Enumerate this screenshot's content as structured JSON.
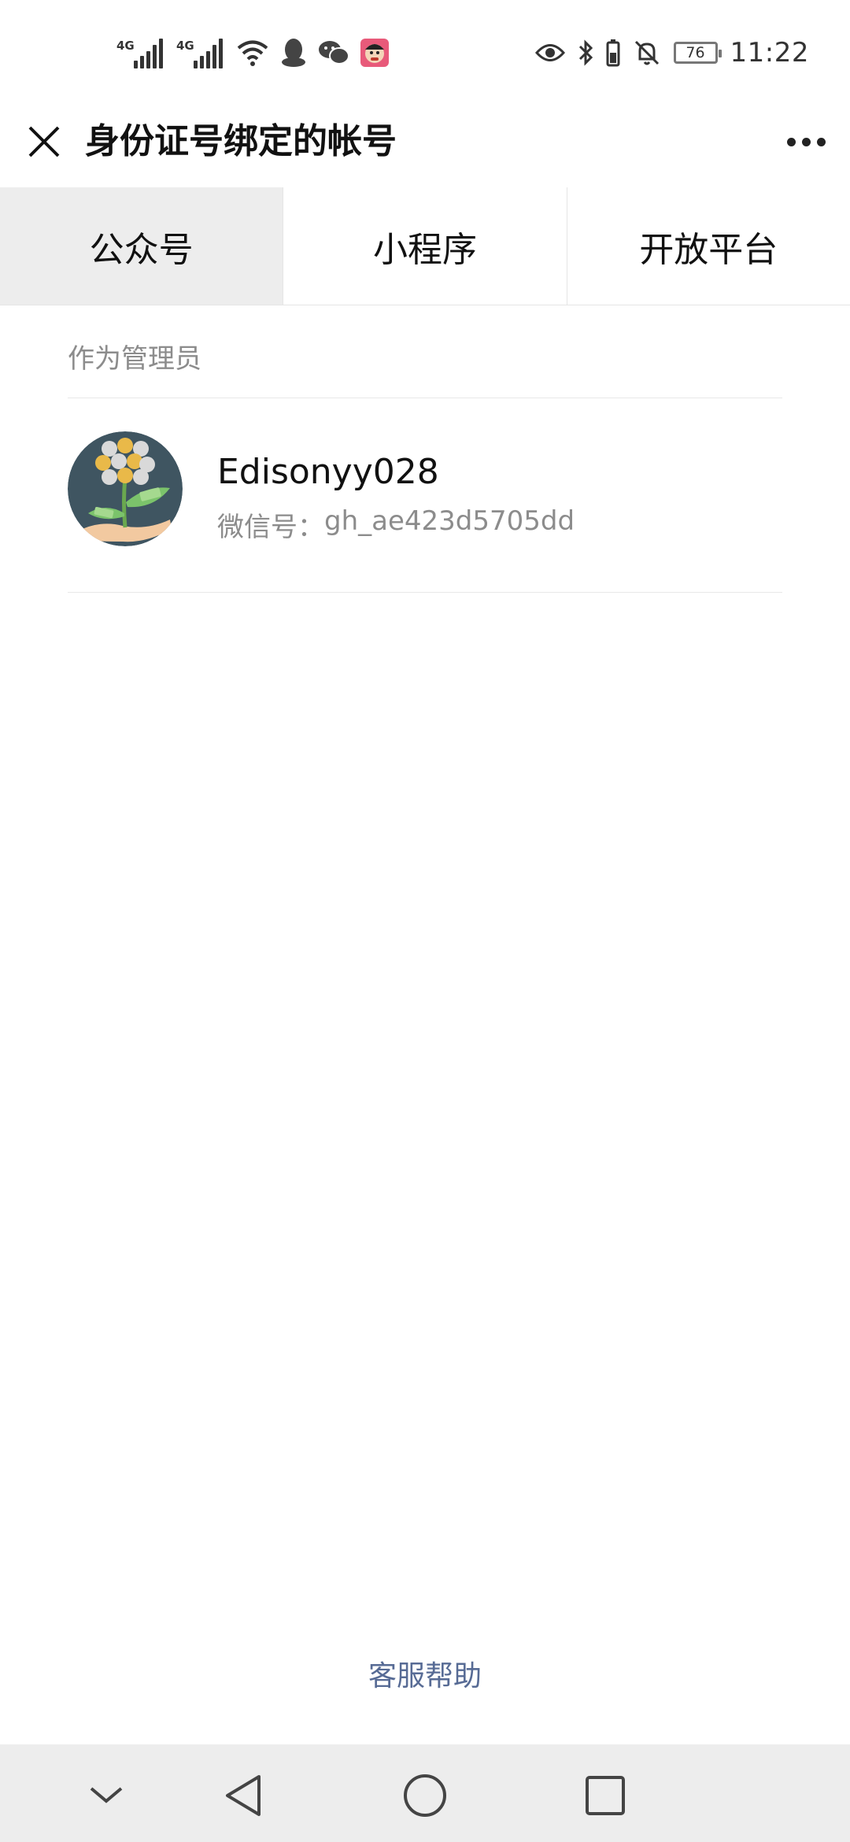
{
  "status_bar": {
    "signal_1_tag": "4G",
    "signal_2_tag": "4G",
    "battery_level": "76",
    "time": "11:22",
    "icons": [
      "signal-icon",
      "signal-icon",
      "wifi-icon",
      "qq-icon",
      "wechat-icon",
      "app-avatar-icon",
      "eye-icon",
      "bluetooth-icon",
      "battery-saver-icon",
      "bell-off-icon",
      "battery-icon"
    ]
  },
  "header": {
    "title": "身份证号绑定的帐号",
    "close_icon": "close-icon",
    "more_icon": "more-icon"
  },
  "tabs": [
    {
      "label": "公众号",
      "active": true
    },
    {
      "label": "小程序",
      "active": false
    },
    {
      "label": "开放平台",
      "active": false
    }
  ],
  "section": {
    "title": "作为管理员"
  },
  "accounts": [
    {
      "name": "Edisonyy028",
      "id_label": "微信号：",
      "id_value": "gh_ae423d5705dd",
      "avatar_icon": "money-plant-avatar"
    }
  ],
  "footer": {
    "help_link": "客服帮助"
  },
  "nav_bar": {
    "icons": [
      "chevron-down-icon",
      "back-triangle-icon",
      "home-circle-icon",
      "recents-square-icon"
    ]
  },
  "colors": {
    "link": "#576b95",
    "active_tab_bg": "#ededed",
    "secondary_text": "#8c8c8c",
    "nav_bg": "#ededed"
  }
}
